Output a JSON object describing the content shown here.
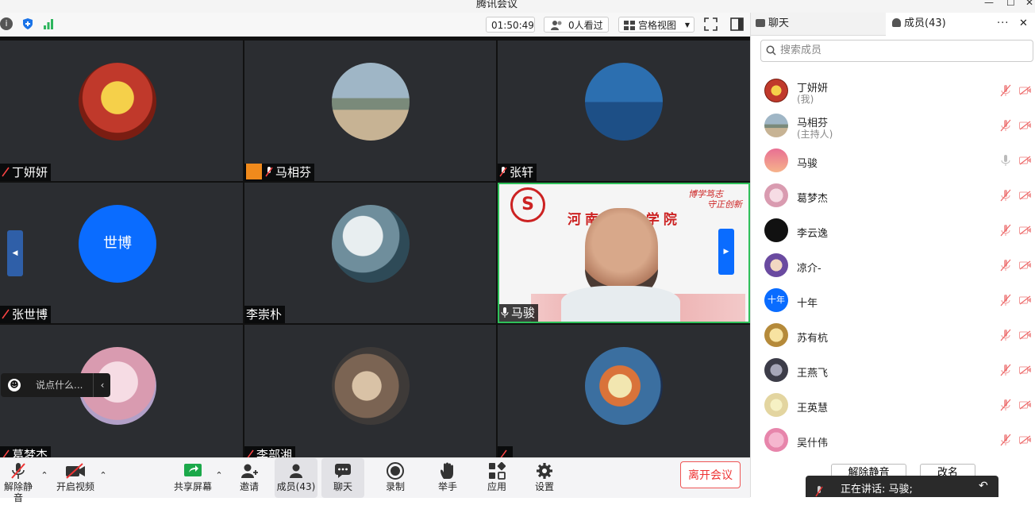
{
  "window": {
    "title": "腾讯会议"
  },
  "toolbar": {
    "time": "01:50:49",
    "viewers": "0人看过",
    "view_mode": "宫格视图"
  },
  "tiles": [
    {
      "name": "丁妍妍",
      "muted": true
    },
    {
      "name": "马相芬",
      "muted": true,
      "host": true
    },
    {
      "name": "张轩",
      "muted": true
    },
    {
      "name": "张世博",
      "muted": true,
      "avatar_text": "世博"
    },
    {
      "name": "李崇朴",
      "muted": false
    },
    {
      "name": "马骏",
      "muted": false,
      "speaking": true
    },
    {
      "name": "葛梦杰",
      "muted": true
    },
    {
      "name": "李部湘",
      "muted": true
    },
    {
      "name": "",
      "muted": true
    }
  ],
  "banner": {
    "motto1": "博学笃志",
    "motto2": "守正创新",
    "school": "河南大学 学院"
  },
  "chat_popup": {
    "placeholder": "说点什么..."
  },
  "bottom": {
    "unmute": "解除静音",
    "video": "开启视频",
    "share": "共享屏幕",
    "invite": "邀请",
    "members": "成员(43)",
    "chat": "聊天",
    "record": "录制",
    "raise": "举手",
    "apps": "应用",
    "settings": "设置",
    "leave": "离开会议"
  },
  "panel": {
    "tab_chat": "聊天",
    "tab_members": "成员(43)",
    "search_placeholder": "搜索成员",
    "members": [
      {
        "name": "丁妍妍",
        "sub": "(我)"
      },
      {
        "name": "马相芬",
        "sub": "(主持人)"
      },
      {
        "name": "马骏",
        "sub": ""
      },
      {
        "name": "葛梦杰",
        "sub": ""
      },
      {
        "name": "李云逸",
        "sub": ""
      },
      {
        "name": "凉介-",
        "sub": ""
      },
      {
        "name": "十年",
        "sub": "",
        "avatar_text": "十年"
      },
      {
        "name": "苏有杭",
        "sub": ""
      },
      {
        "name": "王燕飞",
        "sub": ""
      },
      {
        "name": "王英慧",
        "sub": ""
      },
      {
        "name": "吴什伟",
        "sub": ""
      }
    ],
    "unmute_all": "解除静音",
    "rename": "改名"
  },
  "speaking_toast": {
    "text": "正在讲话: 马骏;"
  },
  "colors": {
    "accent": "#0a6cff",
    "leave": "#e33333",
    "tile_bg": "#2b2d31"
  }
}
